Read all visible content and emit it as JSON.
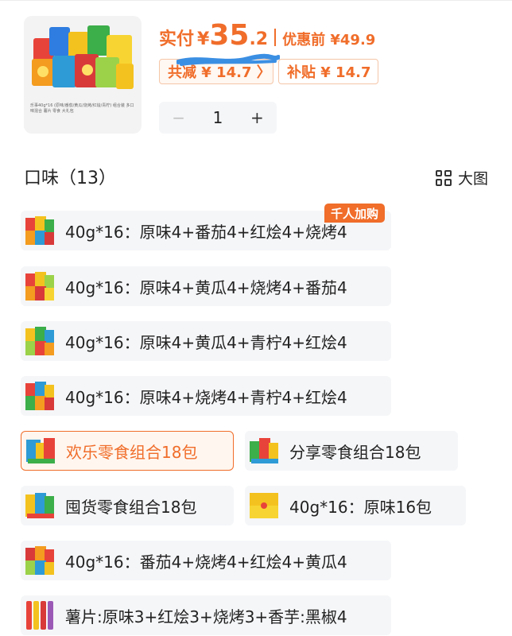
{
  "product": {
    "thumbnail_icon": "snack-bundle-thumbnail-icon",
    "thumbnail_caption": "乐事40g*16 (原味/番茄/黄瓜/烧烤/红烩/青柠) 组合装 多口味混合 薯片 零食 大礼包"
  },
  "price": {
    "label": "实付",
    "currency": "¥",
    "integer": "35",
    "decimal": ".2",
    "original": "优惠前 ¥49.9",
    "total_discount": "共减 ¥ 14.7 〉",
    "subsidy": "补贴 ¥ 14.7"
  },
  "quantity": {
    "minus": "−",
    "value": "1",
    "plus": "+"
  },
  "flavors": {
    "title": "口味（13）",
    "view_label": "大图",
    "view_icon": "grid-view-icon",
    "badge": "千人加购",
    "options": [
      {
        "label": "40g*16：原味4+番茄4+红烩4+烧烤4",
        "icon": "chips-multi-bag-icon"
      },
      {
        "label": "40g*16：原味4+黄瓜4+烧烤4+番茄4",
        "icon": "chips-multi-bag-icon"
      },
      {
        "label": "40g*16：原味4+黄瓜4+青柠4+红烩4",
        "icon": "chips-multi-bag-icon"
      },
      {
        "label": "40g*16：原味4+烧烤4+青柠4+红烩4",
        "icon": "chips-multi-bag-icon"
      },
      {
        "label": "欢乐零食组合18包",
        "icon": "snack-combo-icon",
        "selected": true
      },
      {
        "label": "分享零食组合18包",
        "icon": "snack-combo-icon"
      },
      {
        "label": "囤货零食组合18包",
        "icon": "snack-combo-icon"
      },
      {
        "label": "40g*16：原味16包",
        "icon": "chips-original-icon"
      },
      {
        "label": "40g*16：番茄4+烧烤4+红烩4+黄瓜4",
        "icon": "chips-multi-bag-icon"
      },
      {
        "label": "薯片:原味3+红烩3+烧烤3+香芋:黑椒4",
        "icon": "chips-tube-icon"
      }
    ]
  },
  "colors": {
    "accent": "#f06d2a",
    "option_bg": "#f5f6f8"
  }
}
